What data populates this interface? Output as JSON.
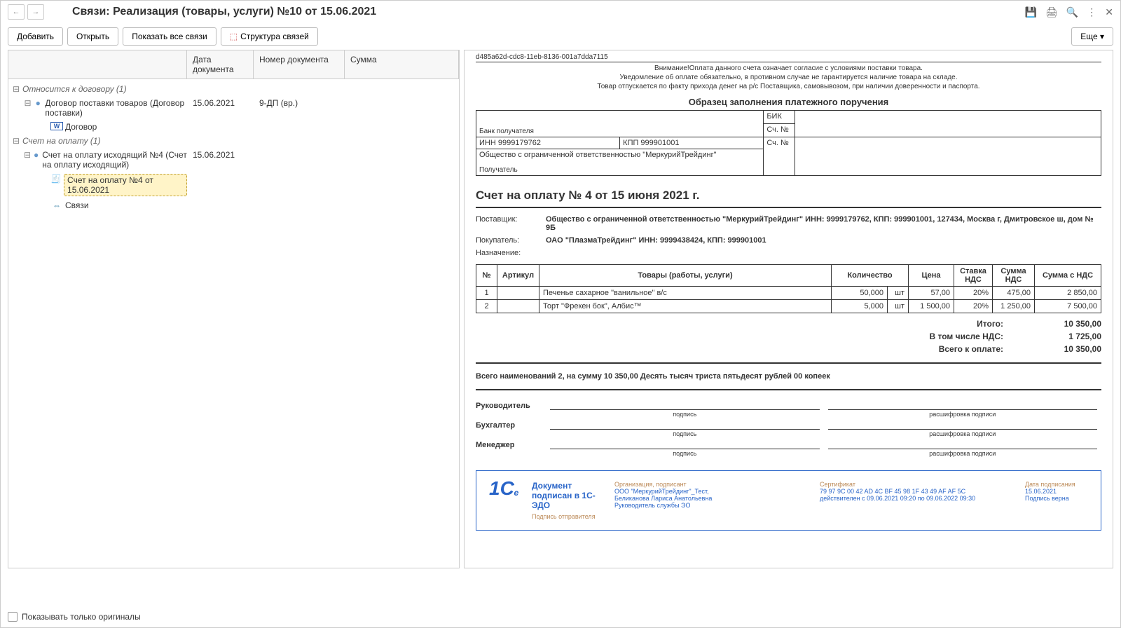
{
  "title": "Связи: Реализация (товары, услуги) №10 от 15.06.2021",
  "toolbar": {
    "add": "Добавить",
    "open": "Открыть",
    "show_all": "Показать все связи",
    "structure": "Структура связей",
    "more": "Еще"
  },
  "tree_columns": {
    "date": "Дата документа",
    "num": "Номер документа",
    "sum": "Сумма"
  },
  "tree": {
    "g1": {
      "label": "Относится к договору (1)"
    },
    "g1_i1": {
      "label": "Договор поставки товаров (Договор поставки)",
      "date": "15.06.2021",
      "num": "9-ДП (вр.)"
    },
    "g1_i1_a": {
      "label": "Договор"
    },
    "g2": {
      "label": "Счет на оплату (1)"
    },
    "g2_i1": {
      "label": "Счет на оплату исходящий №4 (Счет на оплату исходящий)",
      "date": "15.06.2021"
    },
    "g2_i1_a": {
      "label": "Счет на оплату №4 от 15.06.2021"
    },
    "g2_i1_b": {
      "label": "Связи"
    }
  },
  "doc": {
    "id": "d485a62d-cdc8-11eb-8136-001a7dda7115",
    "notice1": "Внимание!Оплата данного счета означает согласие с условиями поставки товара.",
    "notice2": "Уведомление об оплате обязательно, в противном случае не гарантируется наличие товара на складе.",
    "notice3": "Товар отпускается по факту прихода денег на р/с Поставщика, самовывозом, при наличии доверенности и паспорта.",
    "sample_title": "Образец заполнения платежного поручения",
    "bank": {
      "recipient_bank": "Банк получателя",
      "bik": "БИК",
      "acc": "Сч. №",
      "inn": "ИНН  9999179762",
      "kpp": "КПП   999901001",
      "acc2": "Сч. №",
      "org": "Общество с ограниченной ответственностью \"МеркурийТрейдинг\"",
      "recipient": "Получатель"
    },
    "inv_title": "Счет на оплату № 4 от 15 июня 2021 г.",
    "supplier_label": "Поставщик:",
    "supplier": "Общество с ограниченной ответственностью \"МеркурийТрейдинг\" ИНН: 9999179762, КПП: 999901001, 127434, Москва г, Дмитровское ш, дом № 9Б",
    "buyer_label": "Покупатель:",
    "buyer": "ОАО \"ПлазмаТрейдинг\" ИНН: 9999438424, КПП: 999901001",
    "purpose_label": "Назначение:",
    "cols": {
      "n": "№",
      "art": "Артикул",
      "name": "Товары (работы, услуги)",
      "qty": "Количество",
      "price": "Цена",
      "rate": "Ставка НДС",
      "vat": "Сумма НДС",
      "sum": "Сумма с НДС"
    },
    "items": [
      {
        "n": "1",
        "name": "Печенье сахарное \"ванильное\" в/с",
        "qty": "50,000",
        "unit": "шт",
        "price": "57,00",
        "rate": "20%",
        "vat": "475,00",
        "sum": "2 850,00"
      },
      {
        "n": "2",
        "name": "Торт \"Фрекен бок\", Албис™",
        "qty": "5,000",
        "unit": "шт",
        "price": "1 500,00",
        "rate": "20%",
        "vat": "1 250,00",
        "sum": "7 500,00"
      }
    ],
    "totals": {
      "l1": "Итого:",
      "v1": "10 350,00",
      "l2": "В том числе НДС:",
      "v2": "1 725,00",
      "l3": "Всего к оплате:",
      "v3": "10 350,00"
    },
    "in_words": "Всего наименований 2, на сумму 10 350,00 Десять тысяч триста пятьдесят рублей 00 копеек",
    "sign": {
      "head": "Руководитель",
      "acc": "Бухгалтер",
      "mgr": "Менеджер",
      "sig": "подпись",
      "name": "расшифровка подписи"
    },
    "seal": {
      "title": "Документ подписан в 1С-ЭДО",
      "sender": "Подпись отправителя",
      "org_l": "Организация, подписант",
      "org1": "ООО \"МеркурийТрейдинг\"_Тест,",
      "org2": "Беликанова Лариса Анатольевна",
      "org3": "Руководитель службы ЭО",
      "cert_l": "Сертификат",
      "cert1": "79 97 9C 00 42 AD 4C BF 45 98 1F 43 49 AF AF 5C",
      "cert2": "действителен с 09.06.2021 09:20 по 09.06.2022 09:30",
      "date_l": "Дата подписания",
      "date1": "15.06.2021",
      "date2": "Подпись верна"
    }
  },
  "footer": {
    "originals_only": "Показывать только оригиналы"
  }
}
